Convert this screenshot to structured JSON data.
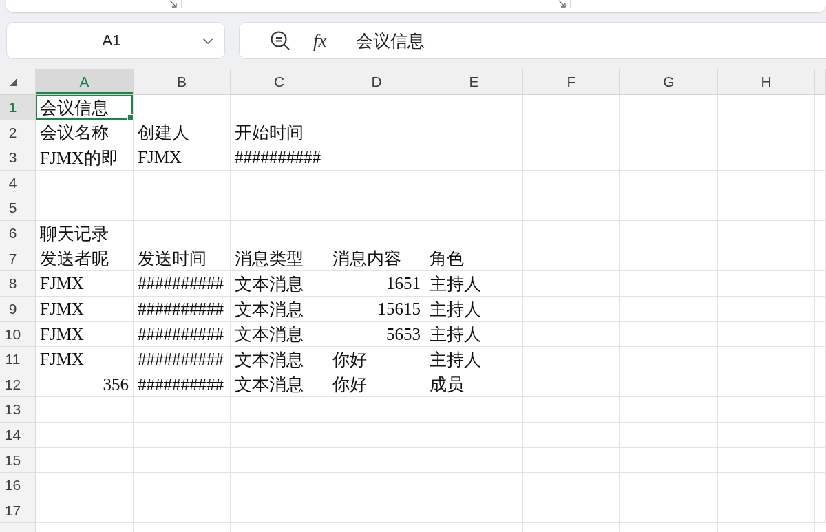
{
  "name_box": {
    "value": "A1"
  },
  "formula_bar": {
    "function_label": "fx",
    "value": "会议信息"
  },
  "grid": {
    "columns": [
      {
        "label": "A",
        "selected": true
      },
      {
        "label": "B",
        "selected": false
      },
      {
        "label": "C",
        "selected": false
      },
      {
        "label": "D",
        "selected": false
      },
      {
        "label": "E",
        "selected": false
      },
      {
        "label": "F",
        "selected": false
      },
      {
        "label": "G",
        "selected": false
      },
      {
        "label": "H",
        "selected": false
      }
    ],
    "rows": [
      {
        "label": "1",
        "selected": true,
        "cells": [
          {
            "text": "会议信息",
            "kind": "text",
            "selected": true
          }
        ]
      },
      {
        "label": "2",
        "selected": false,
        "cells": [
          {
            "text": "会议名称",
            "kind": "text",
            "selected": false
          },
          {
            "text": "创建人",
            "kind": "text",
            "selected": false
          },
          {
            "text": "开始时间",
            "kind": "text",
            "selected": false
          }
        ]
      },
      {
        "label": "3",
        "selected": false,
        "cells": [
          {
            "text": "FJMX的即",
            "kind": "text",
            "selected": false
          },
          {
            "text": "FJMX",
            "kind": "text",
            "selected": false
          },
          {
            "text": "##########",
            "kind": "text",
            "selected": false
          }
        ]
      },
      {
        "label": "4",
        "selected": false
      },
      {
        "label": "5",
        "selected": false
      },
      {
        "label": "6",
        "selected": false,
        "cells": [
          {
            "text": "聊天记录",
            "kind": "text",
            "selected": false
          }
        ]
      },
      {
        "label": "7",
        "selected": false,
        "cells": [
          {
            "text": "发送者昵",
            "kind": "text",
            "selected": false
          },
          {
            "text": "发送时间",
            "kind": "text",
            "selected": false
          },
          {
            "text": "消息类型",
            "kind": "text",
            "selected": false
          },
          {
            "text": "消息内容",
            "kind": "text",
            "selected": false
          },
          {
            "text": "角色",
            "kind": "text",
            "selected": false
          }
        ]
      },
      {
        "label": "8",
        "selected": false,
        "cells": [
          {
            "text": "FJMX",
            "kind": "text",
            "selected": false
          },
          {
            "text": "##########",
            "kind": "text",
            "selected": false
          },
          {
            "text": "文本消息",
            "kind": "text",
            "selected": false
          },
          {
            "text": "1651",
            "kind": "number",
            "selected": false
          },
          {
            "text": "主持人",
            "kind": "text",
            "selected": false
          }
        ]
      },
      {
        "label": "9",
        "selected": false,
        "cells": [
          {
            "text": "FJMX",
            "kind": "text",
            "selected": false
          },
          {
            "text": "##########",
            "kind": "text",
            "selected": false
          },
          {
            "text": "文本消息",
            "kind": "text",
            "selected": false
          },
          {
            "text": "15615",
            "kind": "number",
            "selected": false
          },
          {
            "text": "主持人",
            "kind": "text",
            "selected": false
          }
        ]
      },
      {
        "label": "10",
        "selected": false,
        "cells": [
          {
            "text": "FJMX",
            "kind": "text",
            "selected": false
          },
          {
            "text": "##########",
            "kind": "text",
            "selected": false
          },
          {
            "text": "文本消息",
            "kind": "text",
            "selected": false
          },
          {
            "text": "5653",
            "kind": "number",
            "selected": false
          },
          {
            "text": "主持人",
            "kind": "text",
            "selected": false
          }
        ]
      },
      {
        "label": "11",
        "selected": false,
        "cells": [
          {
            "text": "FJMX",
            "kind": "text",
            "selected": false
          },
          {
            "text": "##########",
            "kind": "text",
            "selected": false
          },
          {
            "text": "文本消息",
            "kind": "text",
            "selected": false
          },
          {
            "text": "你好",
            "kind": "text",
            "selected": false
          },
          {
            "text": "主持人",
            "kind": "text",
            "selected": false
          }
        ]
      },
      {
        "label": "12",
        "selected": false,
        "cells": [
          {
            "text": "356",
            "kind": "number",
            "selected": false
          },
          {
            "text": "##########",
            "kind": "text",
            "selected": false
          },
          {
            "text": "文本消息",
            "kind": "text",
            "selected": false
          },
          {
            "text": "你好",
            "kind": "text",
            "selected": false
          },
          {
            "text": "成员",
            "kind": "text",
            "selected": false
          }
        ]
      },
      {
        "label": "13",
        "selected": false
      },
      {
        "label": "14",
        "selected": false
      },
      {
        "label": "15",
        "selected": false
      },
      {
        "label": "16",
        "selected": false
      },
      {
        "label": "17",
        "selected": false
      }
    ]
  }
}
